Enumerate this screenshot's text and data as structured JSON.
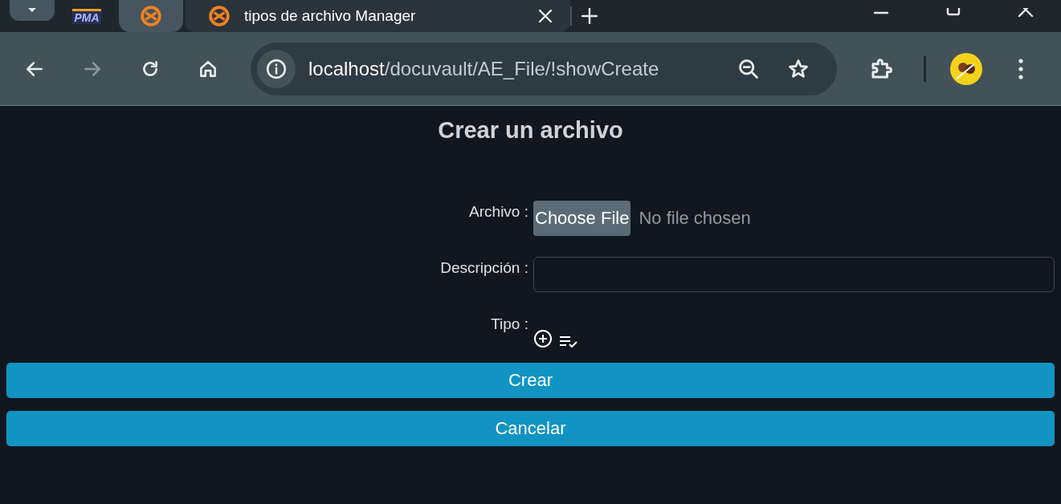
{
  "tabs": [
    {
      "kind": "pinned",
      "logo": "PMA",
      "selected": false
    },
    {
      "kind": "pinned",
      "selected": true
    },
    {
      "kind": "normal",
      "title": "tipos de archivo Manager",
      "selected": false
    }
  ],
  "address_bar": {
    "host": "localhost",
    "path": "/docuvault/AE_File/!showCreate"
  },
  "page": {
    "title": "Crear un archivo",
    "fields": [
      {
        "kind": "file",
        "label": "Archivo :",
        "button": "Choose File",
        "status": "No file chosen"
      },
      {
        "kind": "text",
        "label": "Descripción :"
      },
      {
        "kind": "icons",
        "label": "Tipo :"
      }
    ],
    "buttons": [
      "Crear",
      "Cancelar"
    ]
  }
}
